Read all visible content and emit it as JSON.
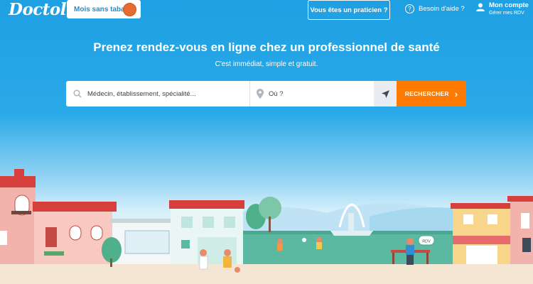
{
  "header": {
    "logo": "Doctolib",
    "promo_label": "Mois sans tabac",
    "pro_button": "Vous êtes un praticien ?",
    "help_label": "Besoin d'aide ?",
    "account_title": "Mon compte",
    "account_subtitle": "Gérer mes RDV"
  },
  "hero": {
    "headline": "Prenez rendez-vous en ligne chez un professionnel de santé",
    "subline": "C'est immédiat, simple et gratuit."
  },
  "search": {
    "query_placeholder": "Médecin, établissement, spécialité...",
    "location_placeholder": "Où ?",
    "button_label": "RECHERCHER"
  },
  "illustration": {
    "bubble_text": "RDV"
  },
  "colors": {
    "brand_blue": "#1ea0e3",
    "search_orange": "#ff7a00",
    "sidewalk": "#f5e6d3"
  },
  "icons": [
    "search-icon",
    "map-pin-icon",
    "locate-arrow-icon",
    "chevron-right-icon",
    "help-icon",
    "user-icon",
    "no-smoking-icon"
  ]
}
